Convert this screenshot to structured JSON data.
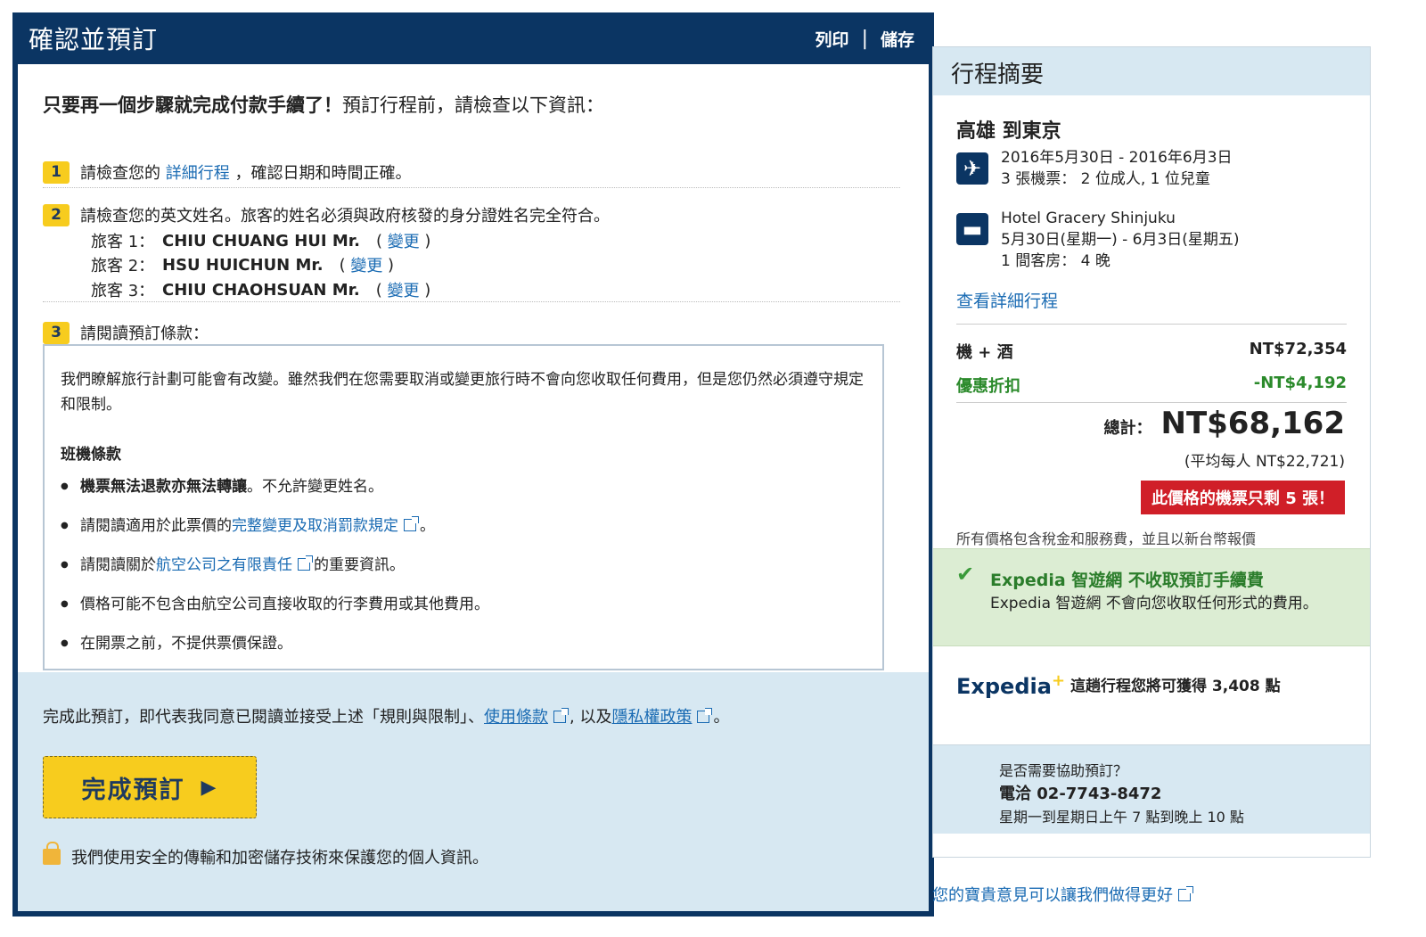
{
  "main": {
    "title": "確認並預訂",
    "actions": {
      "print": "列印",
      "separator": "|",
      "save": "儲存"
    },
    "intro_bold": "只要再一個步驟就完成付款手續了！",
    "intro_rest": "預訂行程前，請檢查以下資訊：",
    "steps": [
      {
        "num": "1",
        "pre": "請檢查您的",
        "link": "詳細行程",
        "post": "，確認日期和時間正確。"
      },
      {
        "num": "2",
        "text": "請檢查您的英文姓名。旅客的姓名必須與政府核發的身分證姓名完全符合。"
      },
      {
        "num": "3",
        "text": "請閱讀預訂條款："
      }
    ],
    "travellers": [
      {
        "label": "旅客 1：",
        "name": "CHIU CHUANG HUI Mr.",
        "change": "變更"
      },
      {
        "label": "旅客 2：",
        "name": "HSU HUICHUN Mr.",
        "change": "變更"
      },
      {
        "label": "旅客 3：",
        "name": "CHIU CHAOHSUAN Mr.",
        "change": "變更"
      }
    ],
    "terms": {
      "intro": "我們瞭解旅行計劃可能會有改變。雖然我們在您需要取消或變更旅行時不會向您收取任何費用，但是您仍然必須遵守規定和限制。",
      "section_title": "班機條款",
      "item1_bold": "機票無法退款亦無法轉讓",
      "item1_rest": "。不允許變更姓名。",
      "item2_pre": "請閱讀適用於此票價的",
      "item2_link": "完整變更及取消罰款規定",
      "item2_post": "。",
      "item3_pre": "請閱讀關於",
      "item3_link": "航空公司之有限責任",
      "item3_post": "的重要資訊。",
      "item4": "價格可能不包含由航空公司直接收取的行李費用或其他費用。",
      "item5": "在開票之前，不提供票價保證。"
    },
    "agree": {
      "pre": "完成此預訂，即代表我同意已閱讀並接受上述「規則與限制」、",
      "terms_link": "使用條款",
      "mid": ", 以及",
      "privacy_link": "隱私權政策",
      "post": "。"
    },
    "complete_button": "完成預訂",
    "security_note": "我們使用安全的傳輸和加密儲存技術來保護您的個人資訊。"
  },
  "summary": {
    "title": "行程摘要",
    "route": "高雄 到東京",
    "flight_dates": "2016年5月30日 - 2016年6月3日",
    "flight_tickets": "3 張機票： 2 位成人, 1 位兒童",
    "hotel_name": "Hotel Gracery Shinjuku",
    "hotel_dates": "5月30日(星期一) - 6月3日(星期五)",
    "hotel_rooms": "1 間客房： 4 晚",
    "view_itinerary": "查看詳細行程",
    "package_label": "機 + 酒",
    "package_price": "NT$72,354",
    "discount_label": "優惠折扣",
    "discount_price": "-NT$4,192",
    "total_label": "總計：",
    "total_price": "NT$68,162",
    "per_person": "(平均每人 NT$22,721)",
    "seats_alert": "此價格的機票只剩 5 張！",
    "tax_note": "所有價格包含稅金和服務費，並且以新台幣報價",
    "no_fee_title": "Expedia 智遊網 不收取預訂手續費",
    "no_fee_text": "Expedia 智遊網 不會向您收取任何形式的費用。",
    "logo_text": "Expedia",
    "logo_plus": "+",
    "points_text": "這趟行程您將可獲得 3,408 點",
    "help_question": "是否需要協助預訂？",
    "help_phone": "電洽 02-7743-8472",
    "help_hours": "星期一到星期日上午 7 點到晚上 10 點"
  },
  "feedback_link": "您的寶貴意見可以讓我們做得更好",
  "colors": {
    "navy": "#0b3563",
    "yellow": "#f7cc1e",
    "link": "#1a6bb3",
    "green": "#2b8a2b",
    "alert": "#d01f28"
  }
}
